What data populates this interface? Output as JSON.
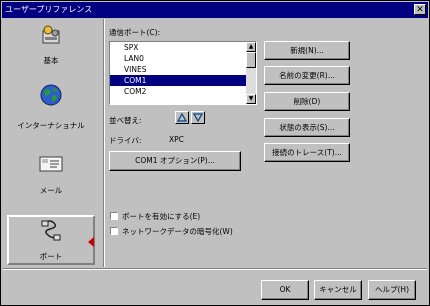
{
  "window": {
    "title": "ユーザープリファレンス",
    "close_label": "✕"
  },
  "sidebar": {
    "items": [
      {
        "label": "基本",
        "icon": "gear-icon"
      },
      {
        "label": "インターナショナル",
        "icon": "globe-icon"
      },
      {
        "label": "メール",
        "icon": "mail-icon"
      },
      {
        "label": "ポート",
        "icon": "port-icon"
      }
    ]
  },
  "ports": {
    "label": "通信ポート(C):",
    "items": [
      "SPX",
      "LAN0",
      "VINES",
      "COM1",
      "COM2"
    ],
    "selected": "COM1"
  },
  "sort": {
    "label": "並べ替え:"
  },
  "driver": {
    "label": "ドライバ:",
    "value": "XPC"
  },
  "options_button": "COM1 オプション(P)...",
  "checkboxes": [
    {
      "label": "ポートを有効にする(E)",
      "checked": false
    },
    {
      "label": "ネットワークデータの暗号化(W)",
      "checked": false
    }
  ],
  "right_buttons": [
    "新規(N)...",
    "名前の変更(R)...",
    "削除(D)",
    "状態の表示(S)...",
    "接続のトレース(T)..."
  ],
  "footer": {
    "ok": "OK",
    "cancel": "キャンセル",
    "help": "ヘルプ(H)"
  },
  "colors": {
    "titlebar": "#000080",
    "selection": "#000080",
    "face": "#c0c0c0",
    "arrow": "#c00000"
  }
}
